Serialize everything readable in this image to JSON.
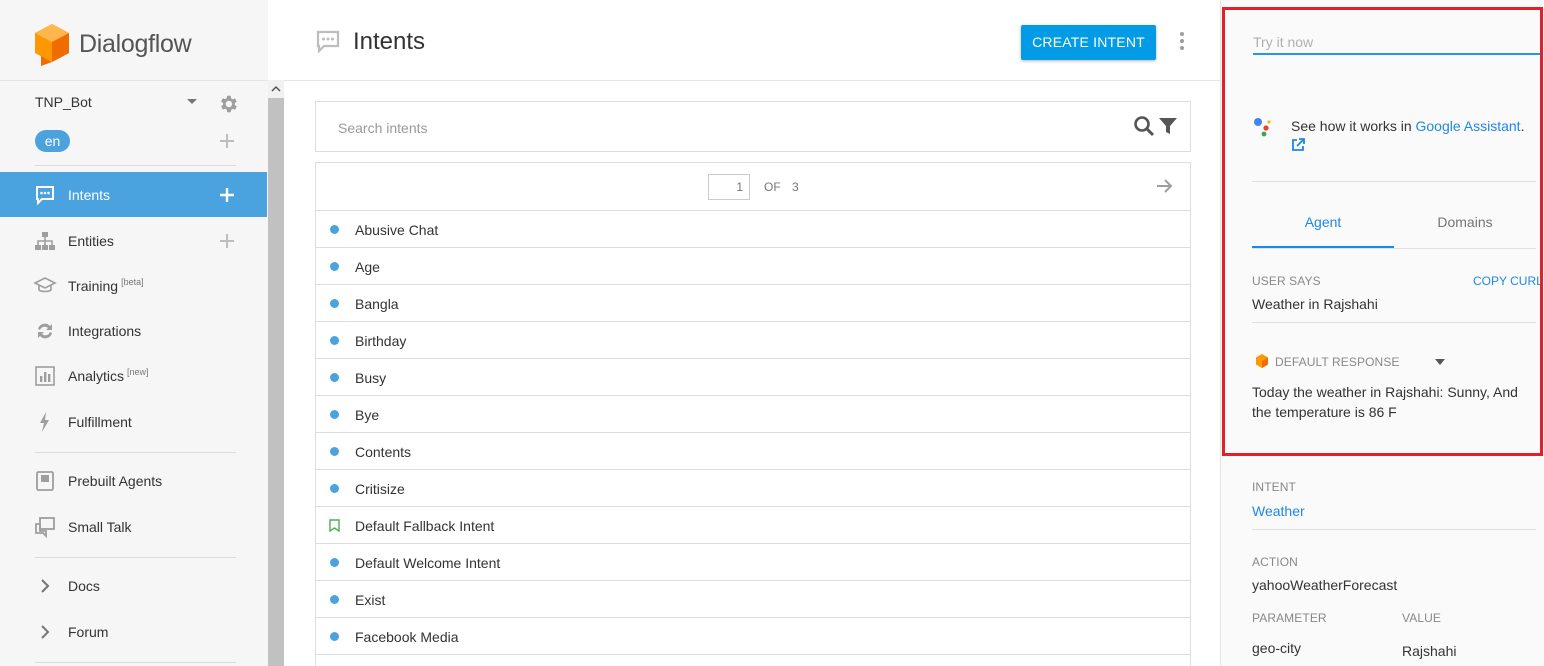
{
  "app": {
    "logo_text": "Dialogflow"
  },
  "sidebar": {
    "agent_name": "TNP_Bot",
    "language": "en",
    "items": [
      {
        "label": "Intents",
        "sup": "",
        "icon": "chat-icon",
        "active": true,
        "has_add": true
      },
      {
        "label": "Entities",
        "sup": "",
        "icon": "hierarchy-icon",
        "active": false,
        "has_add": true
      },
      {
        "label": "Training",
        "sup": "[beta]",
        "icon": "graduation-cap-icon",
        "active": false,
        "has_add": false
      },
      {
        "label": "Integrations",
        "sup": "",
        "icon": "sync-icon",
        "active": false,
        "has_add": false
      },
      {
        "label": "Analytics",
        "sup": "[new]",
        "icon": "bar-chart-icon",
        "active": false,
        "has_add": false
      },
      {
        "label": "Fulfillment",
        "sup": "",
        "icon": "lightning-icon",
        "active": false,
        "has_add": false
      },
      {
        "label": "Prebuilt Agents",
        "sup": "",
        "icon": "book-icon",
        "active": false,
        "has_add": false
      },
      {
        "label": "Small Talk",
        "sup": "",
        "icon": "chat-bubbles-icon",
        "active": false,
        "has_add": false
      },
      {
        "label": "Docs",
        "sup": "",
        "icon": "chevron-right-icon",
        "active": false,
        "has_add": false
      },
      {
        "label": "Forum",
        "sup": "",
        "icon": "chevron-right-icon",
        "active": false,
        "has_add": false
      }
    ]
  },
  "main": {
    "title": "Intents",
    "create_button": "CREATE INTENT",
    "search_placeholder": "Search intents",
    "pager": {
      "current": "1",
      "of_label": "OF",
      "total": "3"
    },
    "intents": [
      {
        "label": "Abusive Chat",
        "marker": "dot"
      },
      {
        "label": "Age",
        "marker": "dot"
      },
      {
        "label": "Bangla",
        "marker": "dot"
      },
      {
        "label": "Birthday",
        "marker": "dot"
      },
      {
        "label": "Busy",
        "marker": "dot"
      },
      {
        "label": "Bye",
        "marker": "dot"
      },
      {
        "label": "Contents",
        "marker": "dot"
      },
      {
        "label": "Critisize",
        "marker": "dot"
      },
      {
        "label": "Default Fallback Intent",
        "marker": "bookmark"
      },
      {
        "label": "Default Welcome Intent",
        "marker": "dot"
      },
      {
        "label": "Exist",
        "marker": "dot"
      },
      {
        "label": "Facebook Media",
        "marker": "dot"
      }
    ]
  },
  "right_panel": {
    "try_placeholder": "Try it now",
    "ga_prefix": "See how it works in ",
    "ga_link": "Google Assistant",
    "ga_suffix": ".",
    "tabs": [
      "Agent",
      "Domains"
    ],
    "user_says_label": "USER SAYS",
    "copy_curl": "COPY CURL",
    "user_says_value": "Weather in Rajshahi",
    "default_response_label": "DEFAULT RESPONSE",
    "default_response_value": "Today the weather in Rajshahi: Sunny, And the temperature is 86 F",
    "intent_label": "INTENT",
    "intent_value": "Weather",
    "action_label": "ACTION",
    "action_value": "yahooWeatherForecast",
    "parameter_label": "PARAMETER",
    "value_label": "VALUE",
    "parameter_value": "geo-city",
    "value_value": "Rajshahi"
  },
  "colors": {
    "accent": "#4aa3df",
    "button": "#039be5",
    "link": "#1e88e5",
    "highlight": "#e0202a",
    "logo_orange": "#ef6c00"
  }
}
